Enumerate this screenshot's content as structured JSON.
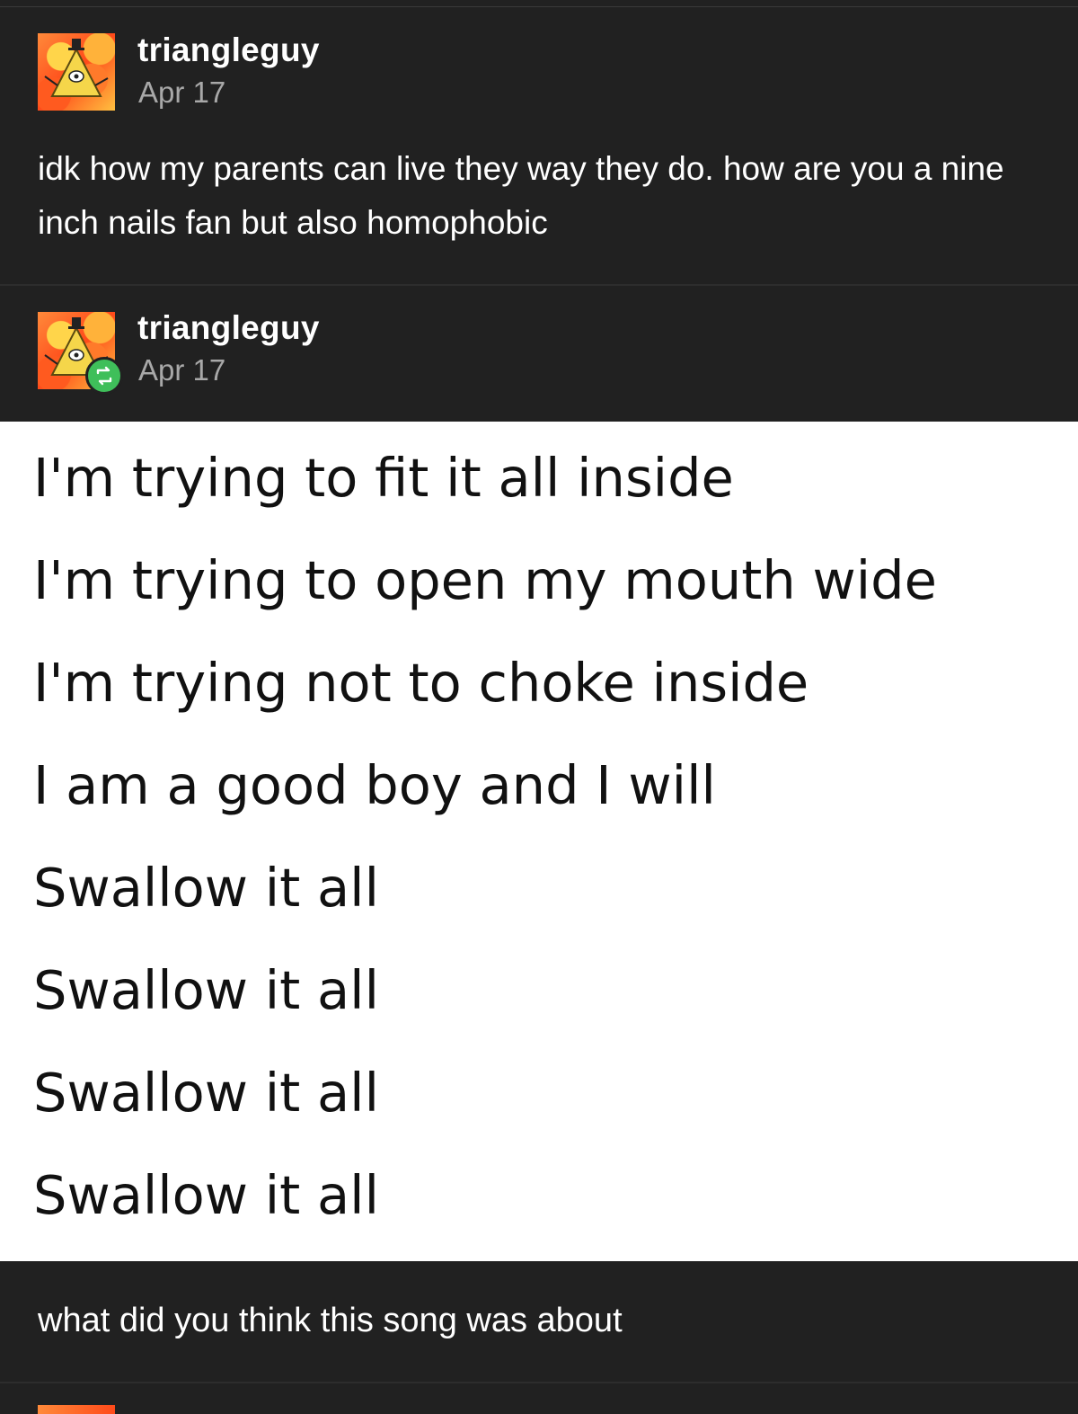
{
  "posts": [
    {
      "username": "triangleguy",
      "date": "Apr 17",
      "text": "idk how my parents can live they way they do. how are you a nine inch nails fan but also homophobic"
    },
    {
      "username": "triangleguy",
      "date": "Apr 17",
      "reblog_icon": "reblog-icon",
      "lyrics": [
        "I'm trying to fit it all inside",
        "I'm trying to open my mouth wide",
        "I'm trying not to choke inside",
        "I am a good boy and I will",
        "Swallow it all",
        "Swallow it all",
        "Swallow it all",
        "Swallow it all"
      ],
      "caption": "what did you think this song was about"
    }
  ],
  "colors": {
    "background": "#212121",
    "reblog_badge": "#3fbf5a",
    "lyrics_panel": "#ffffff"
  }
}
